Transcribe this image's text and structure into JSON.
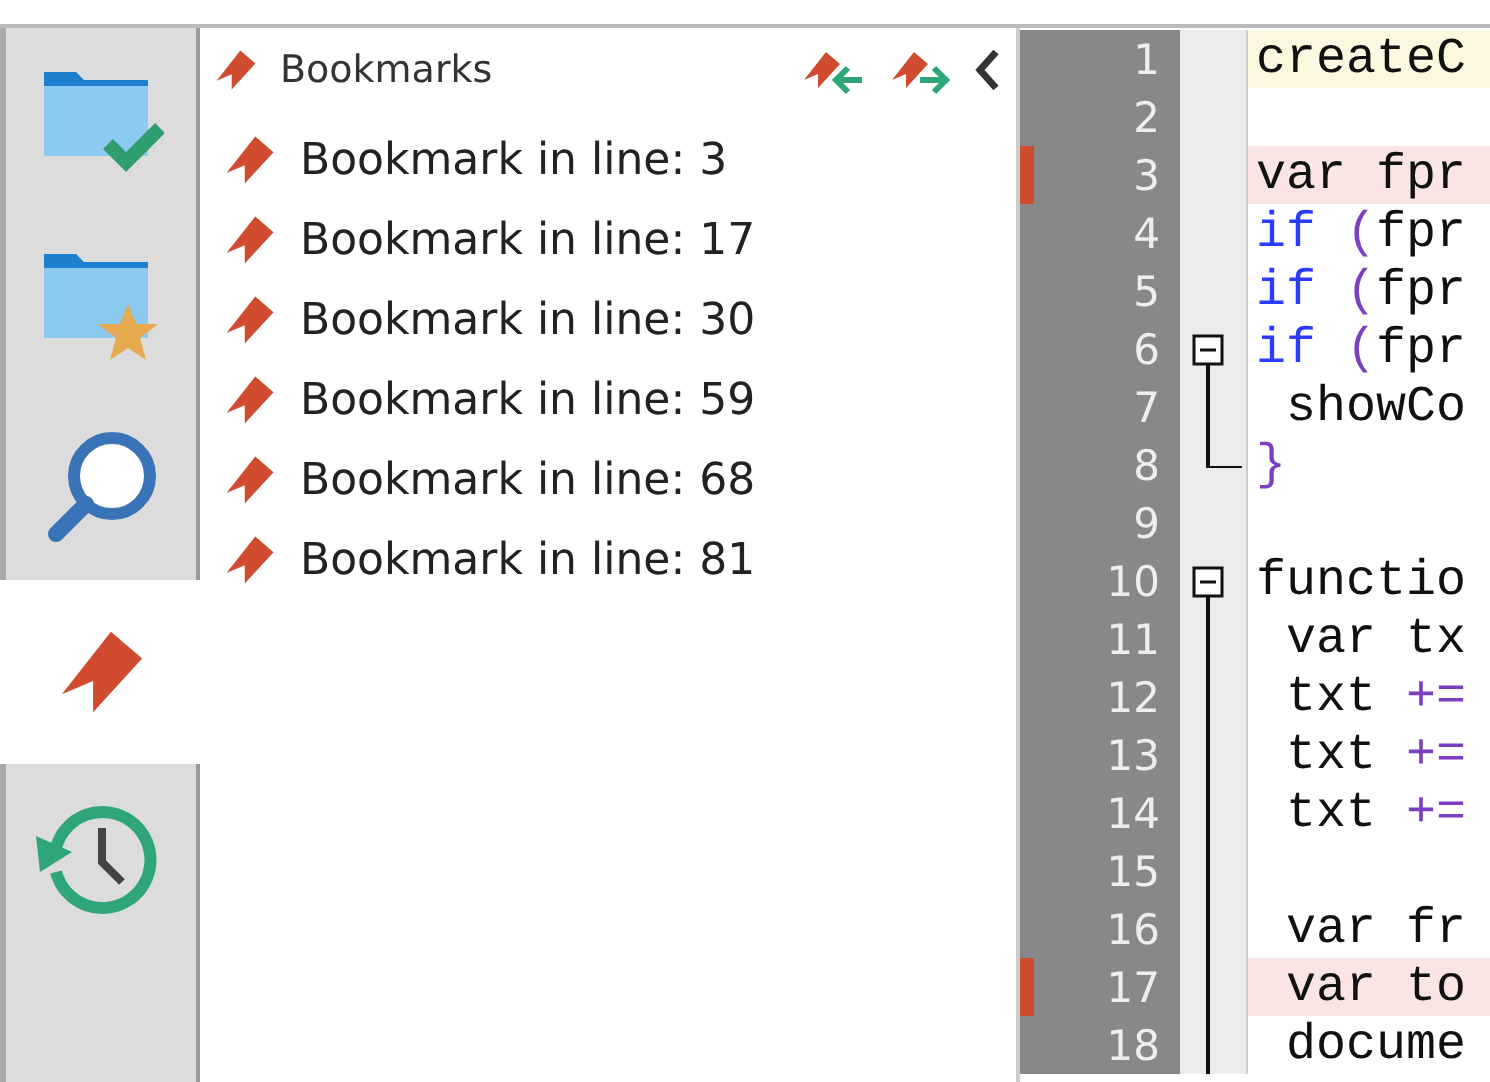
{
  "sidebar": {
    "tabs": [
      {
        "kind": "folder-check",
        "selected": false
      },
      {
        "kind": "folder-star",
        "selected": false
      },
      {
        "kind": "search",
        "selected": false
      },
      {
        "kind": "bookmark",
        "selected": true
      },
      {
        "kind": "history",
        "selected": false
      }
    ]
  },
  "bookmarks_panel": {
    "title": "Bookmarks",
    "items": [
      {
        "label": "Bookmark in line: 3"
      },
      {
        "label": "Bookmark in line: 17"
      },
      {
        "label": "Bookmark in line: 30"
      },
      {
        "label": "Bookmark in line: 59"
      },
      {
        "label": "Bookmark in line: 68"
      },
      {
        "label": "Bookmark in line: 81"
      }
    ]
  },
  "editor": {
    "lines": [
      {
        "number": "1",
        "current": true,
        "bookmarked": false,
        "kind": "plain",
        "tokens": [
          {
            "text": "createC",
            "kind": "plain"
          }
        ]
      },
      {
        "number": "2",
        "current": false,
        "bookmarked": false,
        "kind": "plain"
      },
      {
        "number": "3",
        "current": false,
        "bookmarked": true,
        "kind": "plain",
        "tokens": [
          {
            "text": "var fpr",
            "kind": "plain"
          }
        ]
      },
      {
        "number": "4",
        "current": false,
        "bookmarked": false,
        "kind": "plain",
        "tokens": [
          {
            "text": "if",
            "kind": "keyword"
          },
          {
            "text": " (",
            "kind": "operator"
          },
          {
            "text": "fpr",
            "kind": "plain"
          }
        ]
      },
      {
        "number": "5",
        "current": false,
        "bookmarked": false,
        "kind": "plain",
        "tokens": [
          {
            "text": "if",
            "kind": "keyword"
          },
          {
            "text": " (",
            "kind": "operator"
          },
          {
            "text": "fpr",
            "kind": "plain"
          }
        ]
      },
      {
        "number": "6",
        "current": false,
        "bookmarked": false,
        "kind": "fold-start",
        "tokens": [
          {
            "text": "if",
            "kind": "keyword"
          },
          {
            "text": " (",
            "kind": "operator"
          },
          {
            "text": "fpr",
            "kind": "plain"
          }
        ]
      },
      {
        "number": "7",
        "current": false,
        "bookmarked": false,
        "kind": "fold-body",
        "tokens": [
          {
            "text": " showCo",
            "kind": "plain"
          }
        ]
      },
      {
        "number": "8",
        "current": false,
        "bookmarked": false,
        "kind": "fold-end",
        "tokens": [
          {
            "text": "}",
            "kind": "operator"
          }
        ]
      },
      {
        "number": "9",
        "current": false,
        "bookmarked": false,
        "kind": "plain"
      },
      {
        "number": "10",
        "current": false,
        "bookmarked": false,
        "kind": "fold-start",
        "tokens": [
          {
            "text": "functio",
            "kind": "plain"
          }
        ]
      },
      {
        "number": "11",
        "current": false,
        "bookmarked": false,
        "kind": "fold-body",
        "tokens": [
          {
            "text": " var tx",
            "kind": "plain"
          }
        ]
      },
      {
        "number": "12",
        "current": false,
        "bookmarked": false,
        "kind": "fold-body",
        "tokens": [
          {
            "text": " txt ",
            "kind": "plain"
          },
          {
            "text": "+=",
            "kind": "operator"
          }
        ]
      },
      {
        "number": "13",
        "current": false,
        "bookmarked": false,
        "kind": "fold-body",
        "tokens": [
          {
            "text": " txt ",
            "kind": "plain"
          },
          {
            "text": "+=",
            "kind": "operator"
          }
        ]
      },
      {
        "number": "14",
        "current": false,
        "bookmarked": false,
        "kind": "fold-body",
        "tokens": [
          {
            "text": " txt ",
            "kind": "plain"
          },
          {
            "text": "+=",
            "kind": "operator"
          }
        ]
      },
      {
        "number": "15",
        "current": false,
        "bookmarked": false,
        "kind": "fold-body"
      },
      {
        "number": "16",
        "current": false,
        "bookmarked": false,
        "kind": "fold-body",
        "tokens": [
          {
            "text": " var fr",
            "kind": "plain"
          }
        ]
      },
      {
        "number": "17",
        "current": false,
        "bookmarked": true,
        "kind": "fold-body",
        "tokens": [
          {
            "text": " var to",
            "kind": "plain"
          }
        ]
      },
      {
        "number": "18",
        "current": false,
        "bookmarked": false,
        "kind": "fold-body",
        "tokens": [
          {
            "text": " docume",
            "kind": "plain"
          }
        ]
      }
    ]
  }
}
